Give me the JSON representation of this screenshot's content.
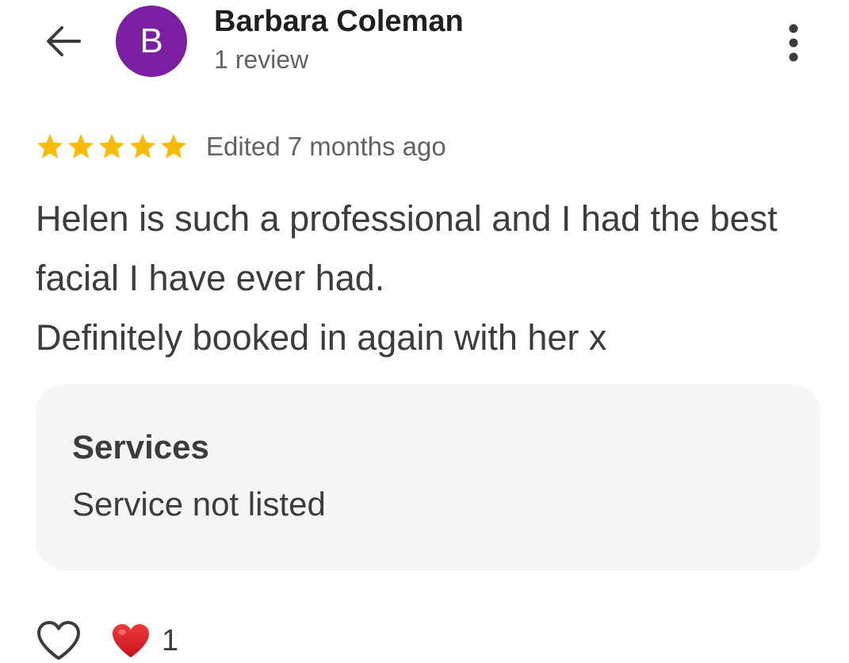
{
  "header": {
    "back_icon": "arrow-left-icon",
    "avatar_letter": "B",
    "avatar_color": "#7b1fa2",
    "reviewer_name": "Barbara Coleman",
    "review_count": "1 review",
    "more_icon": "more-vertical-icon"
  },
  "review": {
    "rating": 5,
    "max_rating": 5,
    "star_color": "#f9bb07",
    "edited_label": "Edited 7 months ago",
    "text_lines": [
      "Helen is such a professional and I had the best facial I have ever had.",
      "Definitely booked in again with her x"
    ]
  },
  "services": {
    "title": "Services",
    "value": "Service not listed"
  },
  "reactions": {
    "like_icon": "heart-outline-icon",
    "reaction_icon": "red-heart-icon",
    "reaction_count": "1"
  }
}
